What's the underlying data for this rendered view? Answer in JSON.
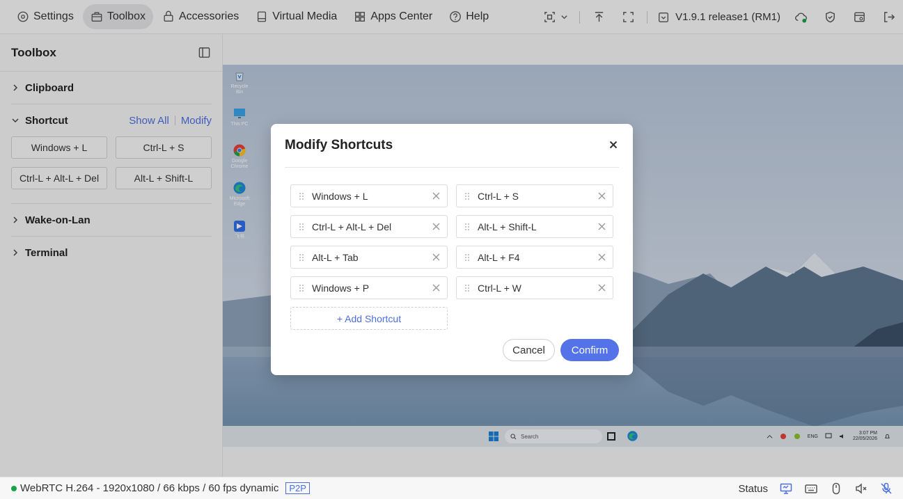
{
  "nav": {
    "items": [
      {
        "label": "Settings",
        "icon": "settings-icon"
      },
      {
        "label": "Toolbox",
        "icon": "toolbox-icon"
      },
      {
        "label": "Accessories",
        "icon": "accessories-icon"
      },
      {
        "label": "Virtual Media",
        "icon": "virtual-media-icon"
      },
      {
        "label": "Apps Center",
        "icon": "apps-icon"
      },
      {
        "label": "Help",
        "icon": "help-icon"
      }
    ],
    "version": "V1.9.1 release1 (RM1)"
  },
  "sidebar": {
    "title": "Toolbox",
    "sections": {
      "clipboard": "Clipboard",
      "shortcut": "Shortcut",
      "wake": "Wake-on-Lan",
      "terminal": "Terminal"
    },
    "show_all": "Show All",
    "modify": "Modify",
    "shortcuts": [
      "Windows + L",
      "Ctrl-L + S",
      "Ctrl-L + Alt-L + Del",
      "Alt-L + Shift-L"
    ]
  },
  "remote": {
    "desktop_icons": [
      "Recycle Bin",
      "This PC",
      "Google Chrome",
      "Microsoft Edge",
      "飞书"
    ],
    "taskbar_search": "Search",
    "tray_lang": "ENG",
    "time": "3:07 PM",
    "date": "22/05/2026"
  },
  "modal": {
    "title": "Modify Shortcuts",
    "items": [
      "Windows + L",
      "Ctrl-L + S",
      "Ctrl-L + Alt-L + Del",
      "Alt-L + Shift-L",
      "Alt-L + Tab",
      "Alt-L + F4",
      "Windows + P",
      "Ctrl-L + W"
    ],
    "add_label": "+ Add Shortcut",
    "cancel": "Cancel",
    "confirm": "Confirm"
  },
  "status": {
    "stream": "WebRTC H.264 - 1920x1080 /  66 kbps / 60 fps dynamic",
    "mode": "P2P",
    "label": "Status"
  },
  "colors": {
    "accent": "#5473e8",
    "link": "#4a6ee0",
    "online": "#16a34a"
  }
}
